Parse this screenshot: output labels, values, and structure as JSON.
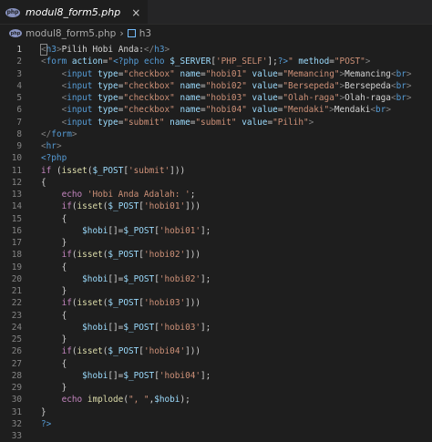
{
  "tab": {
    "label": "modul8_form5.php",
    "close_glyph": "×",
    "icon": "php-file-icon"
  },
  "breadcrumb": {
    "file": "modul8_form5.php",
    "separator": "›",
    "element": "h3"
  },
  "colors": {
    "tag": "#569cd6",
    "punctuation": "#808080",
    "attribute": "#9cdcfe",
    "string": "#ce9178",
    "text": "#d4d4d4",
    "keyword": "#c586c0",
    "function": "#dcdcaa",
    "variable": "#9cdcfe",
    "line_number": "#858585",
    "background": "#1e1e1e"
  },
  "code": {
    "lines": [
      [
        [
          "punc",
          "<"
        ],
        [
          "tag",
          "h3"
        ],
        [
          "punc",
          ">"
        ],
        [
          "text",
          "Pilih Hobi Anda:"
        ],
        [
          "punc",
          "</"
        ],
        [
          "tag",
          "h3"
        ],
        [
          "punc",
          ">"
        ]
      ],
      [
        [
          "punc",
          "<"
        ],
        [
          "tag",
          "form"
        ],
        [
          "text",
          " "
        ],
        [
          "attr",
          "action"
        ],
        [
          "text",
          "="
        ],
        [
          "str",
          "\""
        ],
        [
          "php",
          "<?php"
        ],
        [
          "text",
          " "
        ],
        [
          "php",
          "echo"
        ],
        [
          "text",
          " "
        ],
        [
          "var",
          "$_SERVER"
        ],
        [
          "text",
          "["
        ],
        [
          "str",
          "'PHP_SELF'"
        ],
        [
          "text",
          "];"
        ],
        [
          "php",
          "?>"
        ],
        [
          "str",
          "\""
        ],
        [
          "text",
          " "
        ],
        [
          "attr",
          "method"
        ],
        [
          "text",
          "="
        ],
        [
          "str",
          "\"POST\""
        ],
        [
          "punc",
          ">"
        ]
      ],
      [
        [
          "text",
          "    "
        ],
        [
          "punc",
          "<"
        ],
        [
          "tag",
          "input"
        ],
        [
          "text",
          " "
        ],
        [
          "attr",
          "type"
        ],
        [
          "text",
          "="
        ],
        [
          "str",
          "\"checkbox\""
        ],
        [
          "text",
          " "
        ],
        [
          "attr",
          "name"
        ],
        [
          "text",
          "="
        ],
        [
          "str",
          "\"hobi01\""
        ],
        [
          "text",
          " "
        ],
        [
          "attr",
          "value"
        ],
        [
          "text",
          "="
        ],
        [
          "str",
          "\"Memancing\""
        ],
        [
          "punc",
          ">"
        ],
        [
          "text",
          "Memancing"
        ],
        [
          "punc",
          "<"
        ],
        [
          "tag",
          "br"
        ],
        [
          "punc",
          ">"
        ]
      ],
      [
        [
          "text",
          "    "
        ],
        [
          "punc",
          "<"
        ],
        [
          "tag",
          "input"
        ],
        [
          "text",
          " "
        ],
        [
          "attr",
          "type"
        ],
        [
          "text",
          "="
        ],
        [
          "str",
          "\"checkbox\""
        ],
        [
          "text",
          " "
        ],
        [
          "attr",
          "name"
        ],
        [
          "text",
          "="
        ],
        [
          "str",
          "\"hobi02\""
        ],
        [
          "text",
          " "
        ],
        [
          "attr",
          "value"
        ],
        [
          "text",
          "="
        ],
        [
          "str",
          "\"Bersepeda\""
        ],
        [
          "punc",
          ">"
        ],
        [
          "text",
          "Bersepeda"
        ],
        [
          "punc",
          "<"
        ],
        [
          "tag",
          "br"
        ],
        [
          "punc",
          ">"
        ]
      ],
      [
        [
          "text",
          "    "
        ],
        [
          "punc",
          "<"
        ],
        [
          "tag",
          "input"
        ],
        [
          "text",
          " "
        ],
        [
          "attr",
          "type"
        ],
        [
          "text",
          "="
        ],
        [
          "str",
          "\"checkbox\""
        ],
        [
          "text",
          " "
        ],
        [
          "attr",
          "name"
        ],
        [
          "text",
          "="
        ],
        [
          "str",
          "\"hobi03\""
        ],
        [
          "text",
          " "
        ],
        [
          "attr",
          "value"
        ],
        [
          "text",
          "="
        ],
        [
          "str",
          "\"Olah-raga\""
        ],
        [
          "punc",
          ">"
        ],
        [
          "text",
          "Olah-raga"
        ],
        [
          "punc",
          "<"
        ],
        [
          "tag",
          "br"
        ],
        [
          "punc",
          ">"
        ]
      ],
      [
        [
          "text",
          "    "
        ],
        [
          "punc",
          "<"
        ],
        [
          "tag",
          "input"
        ],
        [
          "text",
          " "
        ],
        [
          "attr",
          "type"
        ],
        [
          "text",
          "="
        ],
        [
          "str",
          "\"checkbox\""
        ],
        [
          "text",
          " "
        ],
        [
          "attr",
          "name"
        ],
        [
          "text",
          "="
        ],
        [
          "str",
          "\"hobi04\""
        ],
        [
          "text",
          " "
        ],
        [
          "attr",
          "value"
        ],
        [
          "text",
          "="
        ],
        [
          "str",
          "\"Mendaki\""
        ],
        [
          "punc",
          ">"
        ],
        [
          "text",
          "Mendaki"
        ],
        [
          "punc",
          "<"
        ],
        [
          "tag",
          "br"
        ],
        [
          "punc",
          ">"
        ]
      ],
      [
        [
          "text",
          "    "
        ],
        [
          "punc",
          "<"
        ],
        [
          "tag",
          "input"
        ],
        [
          "text",
          " "
        ],
        [
          "attr",
          "type"
        ],
        [
          "text",
          "="
        ],
        [
          "str",
          "\"submit\""
        ],
        [
          "text",
          " "
        ],
        [
          "attr",
          "name"
        ],
        [
          "text",
          "="
        ],
        [
          "str",
          "\"submit\""
        ],
        [
          "text",
          " "
        ],
        [
          "attr",
          "value"
        ],
        [
          "text",
          "="
        ],
        [
          "str",
          "\"Pilih\""
        ],
        [
          "punc",
          ">"
        ]
      ],
      [
        [
          "punc",
          "</"
        ],
        [
          "tag",
          "form"
        ],
        [
          "punc",
          ">"
        ]
      ],
      [
        [
          "punc",
          "<"
        ],
        [
          "tag",
          "hr"
        ],
        [
          "punc",
          ">"
        ]
      ],
      [
        [
          "php",
          "<?php"
        ]
      ],
      [
        [
          "kw",
          "if"
        ],
        [
          "text",
          " ("
        ],
        [
          "fn",
          "isset"
        ],
        [
          "text",
          "("
        ],
        [
          "var",
          "$_POST"
        ],
        [
          "text",
          "["
        ],
        [
          "str",
          "'submit'"
        ],
        [
          "text",
          "]))"
        ]
      ],
      [
        [
          "text",
          "{"
        ]
      ],
      [
        [
          "text",
          "    "
        ],
        [
          "kw",
          "echo"
        ],
        [
          "text",
          " "
        ],
        [
          "str",
          "'Hobi Anda Adalah: '"
        ],
        [
          "text",
          ";"
        ]
      ],
      [
        [
          "text",
          "    "
        ],
        [
          "kw",
          "if"
        ],
        [
          "text",
          "("
        ],
        [
          "fn",
          "isset"
        ],
        [
          "text",
          "("
        ],
        [
          "var",
          "$_POST"
        ],
        [
          "text",
          "["
        ],
        [
          "str",
          "'hobi01'"
        ],
        [
          "text",
          "]))"
        ]
      ],
      [
        [
          "text",
          "    {"
        ]
      ],
      [
        [
          "text",
          "        "
        ],
        [
          "var",
          "$hobi"
        ],
        [
          "text",
          "[]="
        ],
        [
          "var",
          "$_POST"
        ],
        [
          "text",
          "["
        ],
        [
          "str",
          "'hobi01'"
        ],
        [
          "text",
          "];"
        ]
      ],
      [
        [
          "text",
          "    }"
        ]
      ],
      [
        [
          "text",
          "    "
        ],
        [
          "kw",
          "if"
        ],
        [
          "text",
          "("
        ],
        [
          "fn",
          "isset"
        ],
        [
          "text",
          "("
        ],
        [
          "var",
          "$_POST"
        ],
        [
          "text",
          "["
        ],
        [
          "str",
          "'hobi02'"
        ],
        [
          "text",
          "]))"
        ]
      ],
      [
        [
          "text",
          "    {"
        ]
      ],
      [
        [
          "text",
          "        "
        ],
        [
          "var",
          "$hobi"
        ],
        [
          "text",
          "[]="
        ],
        [
          "var",
          "$_POST"
        ],
        [
          "text",
          "["
        ],
        [
          "str",
          "'hobi02'"
        ],
        [
          "text",
          "];"
        ]
      ],
      [
        [
          "text",
          "    }"
        ]
      ],
      [
        [
          "text",
          "    "
        ],
        [
          "kw",
          "if"
        ],
        [
          "text",
          "("
        ],
        [
          "fn",
          "isset"
        ],
        [
          "text",
          "("
        ],
        [
          "var",
          "$_POST"
        ],
        [
          "text",
          "["
        ],
        [
          "str",
          "'hobi03'"
        ],
        [
          "text",
          "]))"
        ]
      ],
      [
        [
          "text",
          "    {"
        ]
      ],
      [
        [
          "text",
          "        "
        ],
        [
          "var",
          "$hobi"
        ],
        [
          "text",
          "[]="
        ],
        [
          "var",
          "$_POST"
        ],
        [
          "text",
          "["
        ],
        [
          "str",
          "'hobi03'"
        ],
        [
          "text",
          "];"
        ]
      ],
      [
        [
          "text",
          "    }"
        ]
      ],
      [
        [
          "text",
          "    "
        ],
        [
          "kw",
          "if"
        ],
        [
          "text",
          "("
        ],
        [
          "fn",
          "isset"
        ],
        [
          "text",
          "("
        ],
        [
          "var",
          "$_POST"
        ],
        [
          "text",
          "["
        ],
        [
          "str",
          "'hobi04'"
        ],
        [
          "text",
          "]))"
        ]
      ],
      [
        [
          "text",
          "    {"
        ]
      ],
      [
        [
          "text",
          "        "
        ],
        [
          "var",
          "$hobi"
        ],
        [
          "text",
          "[]="
        ],
        [
          "var",
          "$_POST"
        ],
        [
          "text",
          "["
        ],
        [
          "str",
          "'hobi04'"
        ],
        [
          "text",
          "];"
        ]
      ],
      [
        [
          "text",
          "    }"
        ]
      ],
      [
        [
          "text",
          "    "
        ],
        [
          "kw",
          "echo"
        ],
        [
          "text",
          " "
        ],
        [
          "fn",
          "implode"
        ],
        [
          "text",
          "("
        ],
        [
          "str",
          "\", \""
        ],
        [
          "text",
          ","
        ],
        [
          "var",
          "$hobi"
        ],
        [
          "text",
          ");"
        ]
      ],
      [
        [
          "text",
          "}"
        ]
      ],
      [
        [
          "php",
          "?>"
        ]
      ],
      []
    ]
  }
}
